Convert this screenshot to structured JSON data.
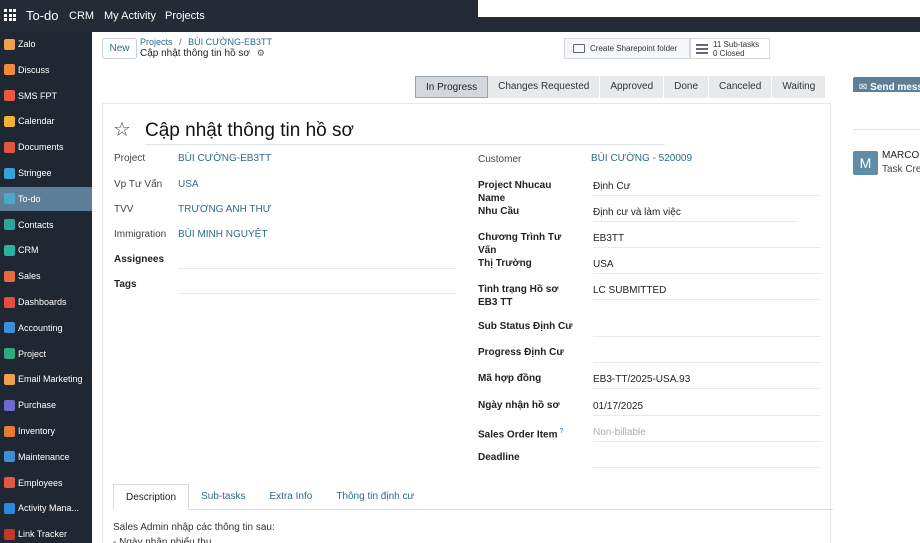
{
  "topbar": {
    "title": "To-do",
    "links": [
      "CRM",
      "My Activity",
      "Projects"
    ]
  },
  "sidebar": {
    "items": [
      {
        "label": "Zalo",
        "icon": "zalo-icon",
        "color": "#f0a04b"
      },
      {
        "label": "Discuss",
        "icon": "discuss-icon",
        "color": "#f58a3c"
      },
      {
        "label": "SMS FPT",
        "icon": "sms-icon",
        "color": "#e95a3d"
      },
      {
        "label": "Calendar",
        "icon": "calendar-icon",
        "color": "#f2b233"
      },
      {
        "label": "Documents",
        "icon": "documents-icon",
        "color": "#e2583e"
      },
      {
        "label": "Stringee",
        "icon": "stringee-icon",
        "color": "#3aa0d8"
      },
      {
        "label": "To-do",
        "icon": "todo-icon",
        "color": "#4aa8c9",
        "active": true
      },
      {
        "label": "Contacts",
        "icon": "contacts-icon",
        "color": "#2fa39a"
      },
      {
        "label": "CRM",
        "icon": "crm-icon",
        "color": "#27b3a0"
      },
      {
        "label": "Sales",
        "icon": "sales-icon",
        "color": "#e7693d"
      },
      {
        "label": "Dashboards",
        "icon": "dashboards-icon",
        "color": "#e74c3c"
      },
      {
        "label": "Accounting",
        "icon": "accounting-icon",
        "color": "#3b8fd6"
      },
      {
        "label": "Project",
        "icon": "project-icon",
        "color": "#2eaa7e"
      },
      {
        "label": "Email Marketing",
        "icon": "email-marketing-icon",
        "color": "#f0a04b"
      },
      {
        "label": "Purchase",
        "icon": "purchase-icon",
        "color": "#6d6ad6"
      },
      {
        "label": "Inventory",
        "icon": "inventory-icon",
        "color": "#e8793a"
      },
      {
        "label": "Maintenance",
        "icon": "maintenance-icon",
        "color": "#3b8fd6"
      },
      {
        "label": "Employees",
        "icon": "employees-icon",
        "color": "#e2583e"
      },
      {
        "label": "Activity Mana...",
        "icon": "activity-icon",
        "color": "#2e86de"
      },
      {
        "label": "Link Tracker",
        "icon": "link-tracker-icon",
        "color": "#c0392b"
      }
    ]
  },
  "control": {
    "new_label": "New",
    "breadcrumb_projects": "Projects",
    "breadcrumb_sep": "/",
    "breadcrumb_project": "BÙI CƯỜNG-EB3TT",
    "record_title": "Cập nhật thông tin hồ sơ",
    "sharepoint_label": "Create Sharepoint folder",
    "subtasks_count": "11 Sub-tasks",
    "subtasks_closed": "0 Closed"
  },
  "stages": [
    "In Progress",
    "Changes Requested",
    "Approved",
    "Done",
    "Canceled",
    "Waiting"
  ],
  "current_stage": "In Progress",
  "send_message": "Send mess",
  "form": {
    "title": "Cập nhật thông tin hồ sơ",
    "left": [
      {
        "label": "Project",
        "value": "BÙI CƯỜNG-EB3TT",
        "link": true
      },
      {
        "label": "Vp Tư Vấn",
        "value": "USA",
        "link": true
      },
      {
        "label": "TVV",
        "value": "TRƯƠNG ANH THƯ",
        "link": true
      },
      {
        "label": "Immigration",
        "value": "BÙI MINH NGUYỆT",
        "link": true
      },
      {
        "label": "Assignees",
        "value": "",
        "bold": true
      },
      {
        "label": "Tags",
        "value": "",
        "bold": true
      }
    ],
    "right": [
      {
        "label": "Customer",
        "value": "BÙI CƯỜNG - 520009",
        "link": true,
        "bold": false
      },
      {
        "label": "Project Nhucau Name",
        "value": "Định Cư"
      },
      {
        "label": "Nhu Cầu",
        "value": "Định cư và làm việc"
      },
      {
        "label": "Chương Trình Tư Vấn",
        "value": "EB3TT"
      },
      {
        "label": "Thị Trường",
        "value": "USA"
      },
      {
        "label": "Tình trạng Hồ sơ EB3 TT",
        "value": "LC SUBMITTED"
      },
      {
        "label": "Sub Status Định Cư",
        "value": ""
      },
      {
        "label": "Progress Định Cư",
        "value": ""
      },
      {
        "label": "Mã hợp đồng",
        "value": "EB3-TT/2025-USA.93"
      },
      {
        "label": "Ngày nhận hồ sơ",
        "value": "01/17/2025"
      },
      {
        "label": "Sales Order Item",
        "value": "Non-billable",
        "placeholder": true,
        "help": "?"
      },
      {
        "label": "Deadline",
        "value": ""
      }
    ]
  },
  "tabs": [
    "Description",
    "Sub-tasks",
    "Extra Info",
    "Thông tin định cư"
  ],
  "active_tab": "Description",
  "description": {
    "line1": "Sales Admin nhập các thông tin sau:",
    "line2": "- Ngày nhận phiếu thu"
  },
  "chatter": {
    "avatar_letter": "M",
    "author": "MARCO I",
    "action": "Task Cre"
  }
}
